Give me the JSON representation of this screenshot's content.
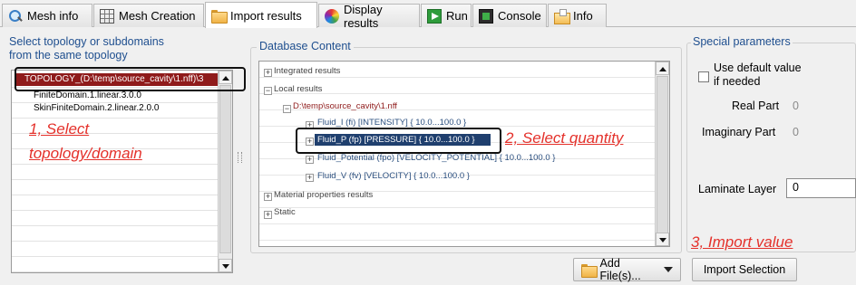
{
  "tabs": [
    {
      "label": "Mesh info",
      "icon": "search-icon"
    },
    {
      "label": "Mesh Creation",
      "icon": "mesh-grid-icon"
    },
    {
      "label": "Import results",
      "icon": "folder-icon"
    },
    {
      "label": "Display results",
      "icon": "color-wheel-icon"
    },
    {
      "label": "Run",
      "icon": "run-icon"
    },
    {
      "label": "Console",
      "icon": "console-icon"
    },
    {
      "label": "Info",
      "icon": "info-folder-icon"
    }
  ],
  "left_panel": {
    "title_line1": "Select topology or subdomains",
    "title_line2": "from the same topology",
    "items": [
      "TOPOLOGY_(D:\\temp\\source_cavity\\1.nff)\\3",
      "FiniteDomain.1.linear.3.0.0",
      "SkinFiniteDomain.2.linear.2.0.0"
    ]
  },
  "database": {
    "title": "Database Content",
    "tree": {
      "integrated": "Integrated results",
      "local": "Local results",
      "file": "D:\\temp\\source_cavity\\1.nff",
      "fluid_i": "Fluid_I (fi) [INTENSITY] { 10.0...100.0 }",
      "fluid_p": "Fluid_P (fp) [PRESSURE] { 10.0...100.0 }",
      "fluid_potential": "Fluid_Potential (fpo) [VELOCITY_POTENTIAL] { 10.0...100.0 }",
      "fluid_v": "Fluid_V (fv) [VELOCITY] { 10.0...100.0 }",
      "material": "Material properties results",
      "static": "Static"
    },
    "expanders": {
      "plus": "+",
      "minus": "−"
    }
  },
  "special": {
    "title": "Special parameters",
    "use_default_line1": "Use default value",
    "use_default_line2": "if needed",
    "real_label": "Real Part",
    "real_value": "0",
    "imag_label": "Imaginary Part",
    "imag_value": "0",
    "laminate_label": "Laminate Layer",
    "laminate_value": "0"
  },
  "buttons": {
    "add_files": "Add File(s)...",
    "import_selection": "Import Selection"
  },
  "annotations": {
    "step1_line1": "1, Select",
    "step1_line2": "topology/domain",
    "step2": "2, Select quantity",
    "step3": "3, Import value"
  },
  "colors": {
    "selected_topology": "#8f1b1b",
    "selected_quantity": "#1f3f6e",
    "annotation": "#e4312b",
    "group_title": "#1f4f8f"
  }
}
